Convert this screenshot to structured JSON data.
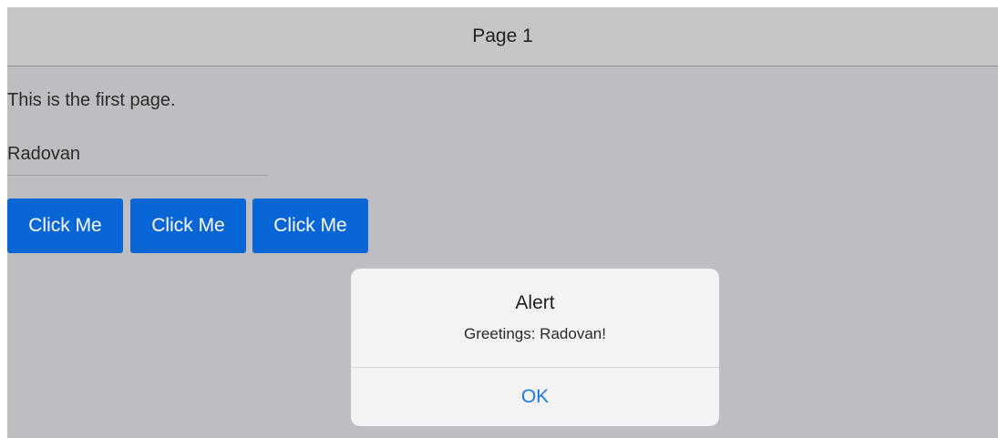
{
  "navbar": {
    "title": "Page 1"
  },
  "content": {
    "text": "This is the first page.",
    "input_value": "Radovan"
  },
  "buttons": [
    {
      "label": "Click Me"
    },
    {
      "label": "Click Me"
    },
    {
      "label": "Click Me"
    }
  ],
  "alert": {
    "title": "Alert",
    "message": "Greetings: Radovan!",
    "ok_label": "OK"
  },
  "colors": {
    "background": "#bebdc2",
    "navbar": "#c6c6c6",
    "button": "#0865d6",
    "alert_link": "#1d79e6"
  }
}
